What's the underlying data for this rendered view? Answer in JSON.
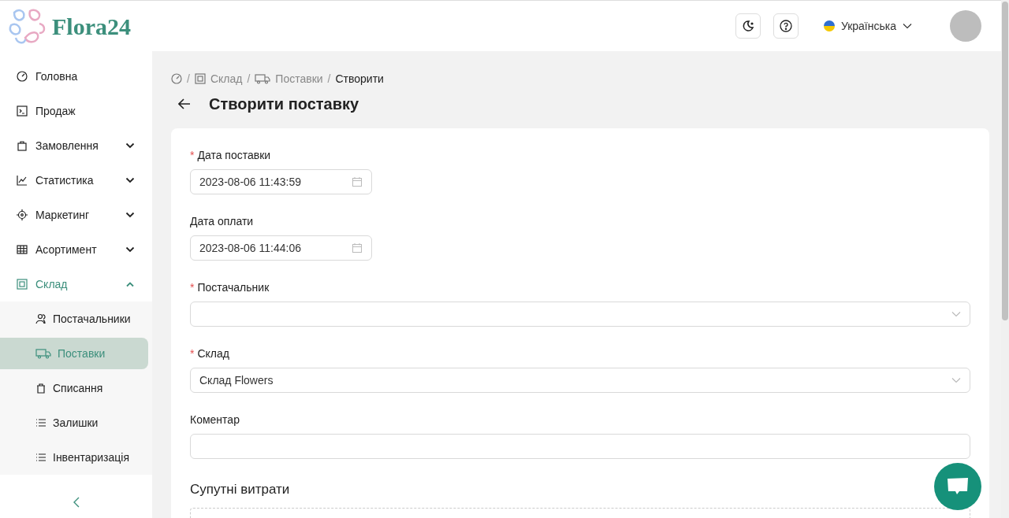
{
  "logo": {
    "text": "Flora24"
  },
  "header": {
    "language": "Українська"
  },
  "sidebar": {
    "items": [
      {
        "label": "Головна",
        "kind": "main",
        "selected": false
      },
      {
        "label": "Продаж",
        "kind": "main",
        "selected": false
      },
      {
        "label": "Замовлення",
        "kind": "group",
        "selected": false,
        "expanded": false
      },
      {
        "label": "Статистика",
        "kind": "group",
        "selected": false,
        "expanded": false
      },
      {
        "label": "Маркетинг",
        "kind": "group",
        "selected": false,
        "expanded": false
      },
      {
        "label": "Асортимент",
        "kind": "group",
        "selected": false,
        "expanded": false
      },
      {
        "label": "Склад",
        "kind": "group",
        "selected": true,
        "expanded": true,
        "children": [
          {
            "label": "Постачальники",
            "selected": false
          },
          {
            "label": "Поставки",
            "selected": true
          },
          {
            "label": "Списання",
            "selected": false
          },
          {
            "label": "Залишки",
            "selected": false
          },
          {
            "label": "Інвентаризація",
            "selected": false
          }
        ]
      }
    ]
  },
  "breadcrumbs": [
    {
      "kind": "home"
    },
    {
      "separator": "/",
      "label": "Склад",
      "kind": "link"
    },
    {
      "separator": "/",
      "label": "Поставки",
      "kind": "link"
    },
    {
      "separator": "/",
      "label": "Створити",
      "kind": "current"
    }
  ],
  "page_title": "Створити поставку",
  "form": {
    "fields": [
      {
        "label": "Дата поставки",
        "required_mark": "*",
        "kind": "date",
        "value": "2023-08-06 11:43:59"
      },
      {
        "label": "Дата оплати",
        "kind": "date",
        "value": "2023-08-06 11:44:06"
      },
      {
        "label": "Постачальник",
        "required_mark": "*",
        "kind": "select"
      },
      {
        "label": "Склад",
        "required_mark": "*",
        "kind": "select",
        "value": "Склад Flowers"
      },
      {
        "label": "Коментар",
        "kind": "text"
      }
    ],
    "section_title": "Супутні витрати"
  }
}
